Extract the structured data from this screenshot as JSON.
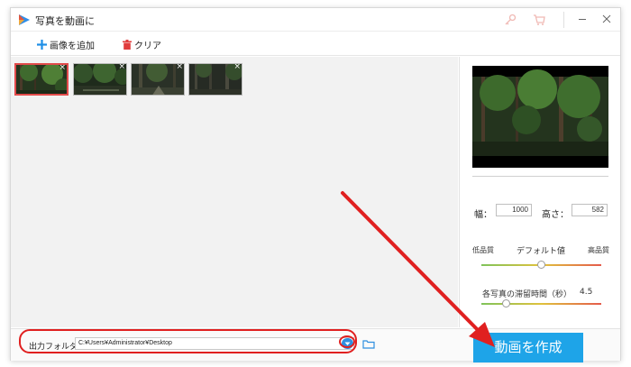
{
  "window": {
    "title": "写真を動画に"
  },
  "toolbar": {
    "add_image": "画像を追加",
    "clear": "クリア"
  },
  "thumbnails": [
    {
      "selected": true
    },
    {
      "selected": false
    },
    {
      "selected": false
    },
    {
      "selected": false
    }
  ],
  "thumbnail_close_glyph": "×",
  "settings": {
    "width_label": "幅：",
    "width_value": "1000",
    "height_label": "高さ：",
    "height_value": "582",
    "quality_low": "低品質",
    "quality_default": "デフォルト値",
    "quality_high": "高品質",
    "duration_label": "各写真の滞留時間（秒）",
    "duration_value": "4.5"
  },
  "bottom": {
    "output_label": "出力フォルダ：",
    "output_path": "C:¥Users¥Administrator¥Desktop",
    "create_button": "動画を作成"
  },
  "colors": {
    "accent": "#1ea4e8",
    "annotation": "#e02020"
  },
  "icons": [
    "app-logo-icon",
    "key-icon",
    "cart-icon",
    "minimize-icon",
    "close-icon",
    "plus-icon",
    "trash-icon",
    "chevron-down-icon",
    "folder-icon"
  ]
}
